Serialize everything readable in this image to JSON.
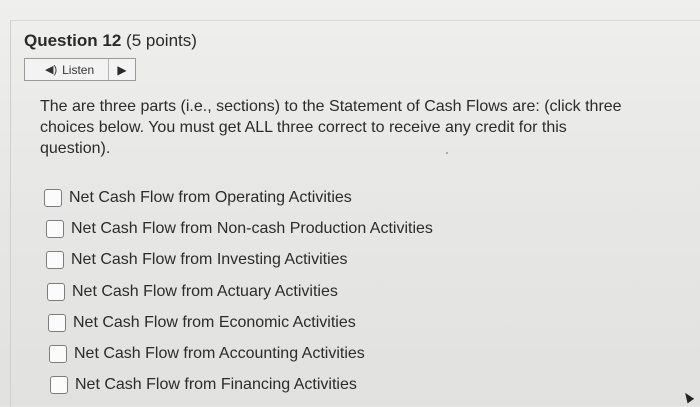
{
  "question": {
    "label": "Question 12",
    "points": "(5 points)"
  },
  "listen": {
    "speaker_icon": "◀)",
    "label": "Listen",
    "play_icon": "▶"
  },
  "prompt": "The are three parts (i.e., sections) to the Statement of Cash Flows are: (click three choices below. You must get ALL three correct to receive any credit for this question).",
  "choices": [
    {
      "label": "Net Cash Flow from Operating Activities"
    },
    {
      "label": "Net Cash Flow from Non-cash Production Activities"
    },
    {
      "label": "Net Cash Flow from Investing Activities"
    },
    {
      "label": "Net Cash Flow from Actuary Activities"
    },
    {
      "label": "Net Cash Flow from Economic Activities"
    },
    {
      "label": "Net Cash Flow from Accounting Activities"
    },
    {
      "label": "Net Cash Flow from Financing Activities"
    }
  ]
}
